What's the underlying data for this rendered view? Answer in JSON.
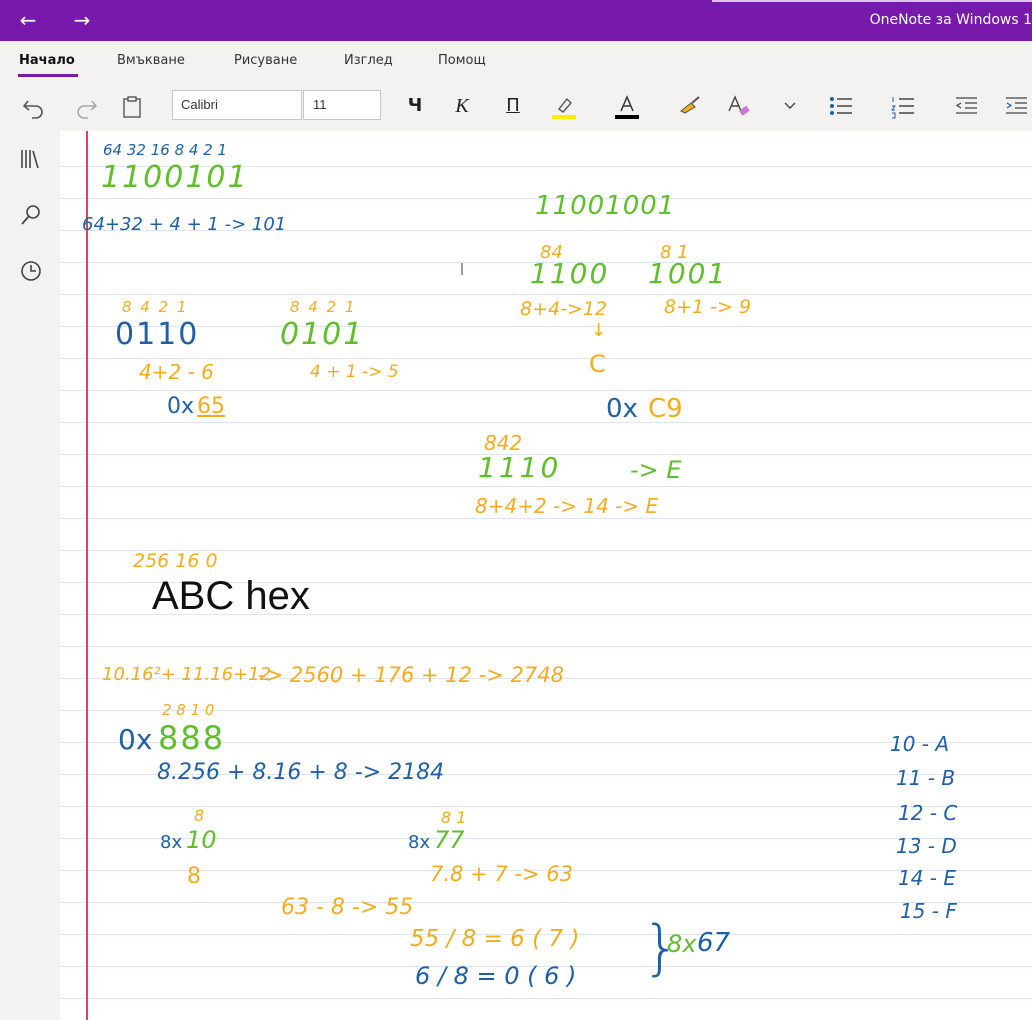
{
  "titlebar": {
    "back_icon": "back-arrow-icon",
    "forward_icon": "forward-arrow-icon",
    "app_title": "OneNote за Windows 1"
  },
  "menu": {
    "tabs": [
      "Начало",
      "Вмъкване",
      "Рисуване",
      "Изглед",
      "Помощ"
    ],
    "active": "Начало"
  },
  "toolbar": {
    "font_name": "Calibri",
    "font_size": "11",
    "bold": "Ч",
    "italic": "К",
    "underline": "П",
    "highlight_color": "#ffee00",
    "font_color": "#000000",
    "icons": [
      "undo-icon",
      "redo-icon",
      "clipboard-icon",
      "highlight-icon",
      "font-color-icon",
      "format-painter-icon",
      "clear-formatting-icon",
      "chevron-down-icon",
      "bullets-icon",
      "numbering-icon",
      "decrease-indent-icon",
      "increase-indent-icon"
    ]
  },
  "siderail": {
    "icons": [
      "notebooks-icon",
      "search-icon",
      "recent-icon"
    ]
  },
  "colors": {
    "accent": "#7719aa",
    "ink_blue": "#1f5fa8",
    "ink_green": "#5fbf2a",
    "ink_orange": "#f4ac1e",
    "margin_red": "#e2454d"
  },
  "notes": {
    "typed": "ABC   hex",
    "ink": [
      {
        "id": "bin-weights",
        "text": "64 32 16 8 4 2 1",
        "color": "blue"
      },
      {
        "id": "bin-1100101",
        "text": "1100101",
        "color": "green"
      },
      {
        "id": "sum-101",
        "text": "64+32  +  4  + 1  -> 101",
        "color": "blue"
      },
      {
        "id": "bin-11001001",
        "text": "11001001",
        "color": "green"
      },
      {
        "id": "w-84",
        "text": "84",
        "color": "orange"
      },
      {
        "id": "w-8-1",
        "text": "8    1",
        "color": "orange"
      },
      {
        "id": "nib-1100",
        "text": "1100",
        "color": "green"
      },
      {
        "id": "nib-1001",
        "text": "1001",
        "color": "green"
      },
      {
        "id": "w-8421-a",
        "text": "8 4 2 1",
        "color": "orange"
      },
      {
        "id": "w-8421-b",
        "text": "8 4 2 1",
        "color": "orange"
      },
      {
        "id": "calc-12",
        "text": "8+4->12",
        "color": "orange"
      },
      {
        "id": "calc-9",
        "text": "8+1 -> 9",
        "color": "orange"
      },
      {
        "id": "nib-0110",
        "text": "0110",
        "color": "blue"
      },
      {
        "id": "nib-0101",
        "text": "0101",
        "color": "green"
      },
      {
        "id": "arrow-down",
        "text": "↓",
        "color": "orange"
      },
      {
        "id": "letter-c",
        "text": "C",
        "color": "orange"
      },
      {
        "id": "calc-6",
        "text": "4+2 - 6",
        "color": "orange"
      },
      {
        "id": "calc-5",
        "text": "4 + 1  -> 5",
        "color": "orange"
      },
      {
        "id": "hex-prefix-a",
        "text": "0x",
        "color": "blue"
      },
      {
        "id": "hex-65",
        "text": "65",
        "color": "orange"
      },
      {
        "id": "hex-prefix-b",
        "text": "0x",
        "color": "blue"
      },
      {
        "id": "hex-c9",
        "text": "C9",
        "color": "orange"
      },
      {
        "id": "w-842",
        "text": "842",
        "color": "orange"
      },
      {
        "id": "bin-1110",
        "text": "1110",
        "color": "green"
      },
      {
        "id": "to-e",
        "text": "-> E",
        "color": "green"
      },
      {
        "id": "calc-14",
        "text": "8+4+2 -> 14 -> E",
        "color": "orange"
      },
      {
        "id": "w-256",
        "text": "256 16 0",
        "color": "orange"
      },
      {
        "id": "calc-2748-a",
        "text": "10.16²+ 11.16+12",
        "color": "orange"
      },
      {
        "id": "calc-2748-b",
        "text": "->  2560 + 176 + 12   ->  2748",
        "color": "orange"
      },
      {
        "id": "w-2810",
        "text": "2 8 1 0",
        "color": "orange"
      },
      {
        "id": "hex-prefix-c",
        "text": "0x",
        "color": "blue"
      },
      {
        "id": "hex-888",
        "text": "888",
        "color": "green"
      },
      {
        "id": "calc-2184",
        "text": "8.256  + 8.16 + 8  ->  2184",
        "color": "blue"
      },
      {
        "id": "w-8",
        "text": "8",
        "color": "orange"
      },
      {
        "id": "w-81",
        "text": "8 1",
        "color": "orange"
      },
      {
        "id": "oct-prefix-a",
        "text": "8x",
        "color": "blue"
      },
      {
        "id": "oct-10",
        "text": "10",
        "color": "green"
      },
      {
        "id": "oct-prefix-b",
        "text": "8x",
        "color": "blue"
      },
      {
        "id": "oct-77",
        "text": "77",
        "color": "green"
      },
      {
        "id": "result-8",
        "text": "8",
        "color": "orange"
      },
      {
        "id": "calc-63",
        "text": "7.8  + 7  ->  63",
        "color": "orange"
      },
      {
        "id": "calc-55",
        "text": "63 - 8  ->  55",
        "color": "orange"
      },
      {
        "id": "div-55",
        "text": "55 / 8  = 6  ( 7 )",
        "color": "orange"
      },
      {
        "id": "div-6",
        "text": "6 / 8  =  0   ( 6 )",
        "color": "blue"
      },
      {
        "id": "brace",
        "text": "}",
        "color": "blue"
      },
      {
        "id": "oct-prefix-c",
        "text": "8x",
        "color": "green"
      },
      {
        "id": "oct-67",
        "text": "67",
        "color": "blue"
      },
      {
        "id": "map-a",
        "text": "10 - A",
        "color": "blue"
      },
      {
        "id": "map-b",
        "text": "11 - B",
        "color": "blue"
      },
      {
        "id": "map-c",
        "text": "12 - C",
        "color": "blue"
      },
      {
        "id": "map-d",
        "text": "13 - D",
        "color": "blue"
      },
      {
        "id": "map-e",
        "text": "14 - E",
        "color": "blue"
      },
      {
        "id": "map-f",
        "text": "15 - F",
        "color": "blue"
      }
    ]
  }
}
